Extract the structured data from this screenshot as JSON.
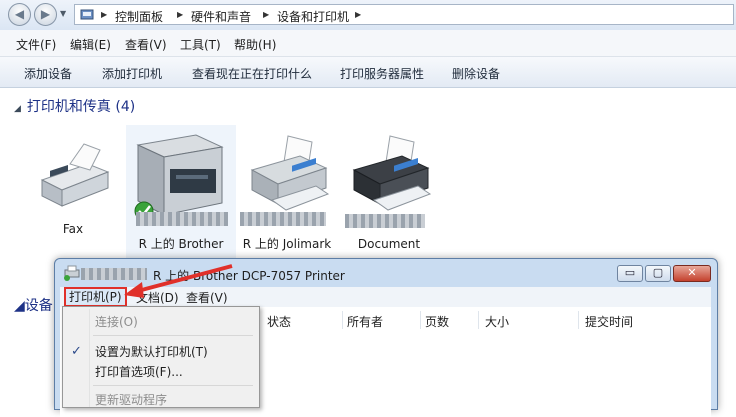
{
  "addressbar": {
    "breadcrumbs": [
      "控制面板",
      "硬件和声音",
      "设备和打印机"
    ]
  },
  "menubar": {
    "items": [
      "文件(F)",
      "编辑(E)",
      "查看(V)",
      "工具(T)",
      "帮助(H)"
    ]
  },
  "commandbar": {
    "items": [
      "添加设备",
      "添加打印机",
      "查看现在正在打印什么",
      "打印服务器属性",
      "删除设备"
    ]
  },
  "printers_group": {
    "header": "打印机和传真 (4)",
    "devices": [
      {
        "label_line1": "Fax",
        "label_line2": "",
        "icon": "fax-icon"
      },
      {
        "label_line1": "R 上的 Brother",
        "label_line2": "DCP-7057",
        "icon": "printer-default-icon"
      },
      {
        "label_line1": "R 上的 Jolimark",
        "label_line2": "FP-...",
        "icon": "printer-icon"
      },
      {
        "label_line1": "Document",
        "label_line2": "...",
        "icon": "printer-icon"
      }
    ]
  },
  "devices_group": {
    "header": "设备"
  },
  "dialog": {
    "title": "R 上的 Brother DCP-7057 Printer",
    "menubar": [
      "打印机(P)",
      "文档(D)",
      "查看(V)"
    ],
    "columns": [
      "状态",
      "所有者",
      "页数",
      "大小",
      "提交时间"
    ],
    "window_buttons": {
      "minimize": "▭",
      "maximize": "▢",
      "close": "✕"
    }
  },
  "printer_menu": {
    "items": [
      {
        "label": "连接(O)",
        "enabled": false,
        "checked": false
      },
      {
        "label": "设置为默认打印机(T)",
        "enabled": true,
        "checked": true
      },
      {
        "label": "打印首选项(F)...",
        "enabled": true,
        "checked": false
      },
      {
        "label": "更新驱动程序",
        "enabled": false,
        "checked": false
      }
    ],
    "check_glyph": "✓"
  },
  "colors": {
    "annotation_red": "#e0302a",
    "group_header": "#1e3287"
  }
}
